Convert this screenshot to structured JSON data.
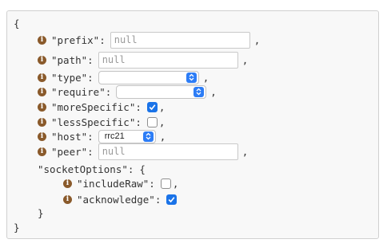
{
  "editor": {
    "open_brace": "{",
    "close_brace": "}",
    "fields": {
      "prefix": {
        "key": "\"prefix\":",
        "placeholder": "null",
        "value": ""
      },
      "path": {
        "key": "\"path\":",
        "placeholder": "null",
        "value": ""
      },
      "type": {
        "key": "\"type\":",
        "value": ""
      },
      "require": {
        "key": "\"require\":",
        "value": ""
      },
      "moreSpecific": {
        "key": "\"moreSpecific\":",
        "checked": true
      },
      "lessSpecific": {
        "key": "\"lessSpecific\":",
        "checked": false
      },
      "host": {
        "key": "\"host\":",
        "value": "rrc21"
      },
      "peer": {
        "key": "\"peer\":",
        "placeholder": "null",
        "value": ""
      }
    },
    "socketOptions": {
      "key": "\"socketOptions\":",
      "open_brace": "{",
      "close_brace": "}",
      "includeRaw": {
        "key": "\"includeRaw\":",
        "checked": false
      },
      "acknowledge": {
        "key": "\"acknowledge\":",
        "checked": true
      }
    },
    "comma": ",",
    "info_glyph": "i"
  },
  "colors": {
    "info_icon": "#8a5a2b",
    "checkbox_checked": "#1a73e8",
    "select_stepper": "#2d7df6",
    "panel_background": "#f8f8f8",
    "panel_border": "#d0d0d0"
  }
}
